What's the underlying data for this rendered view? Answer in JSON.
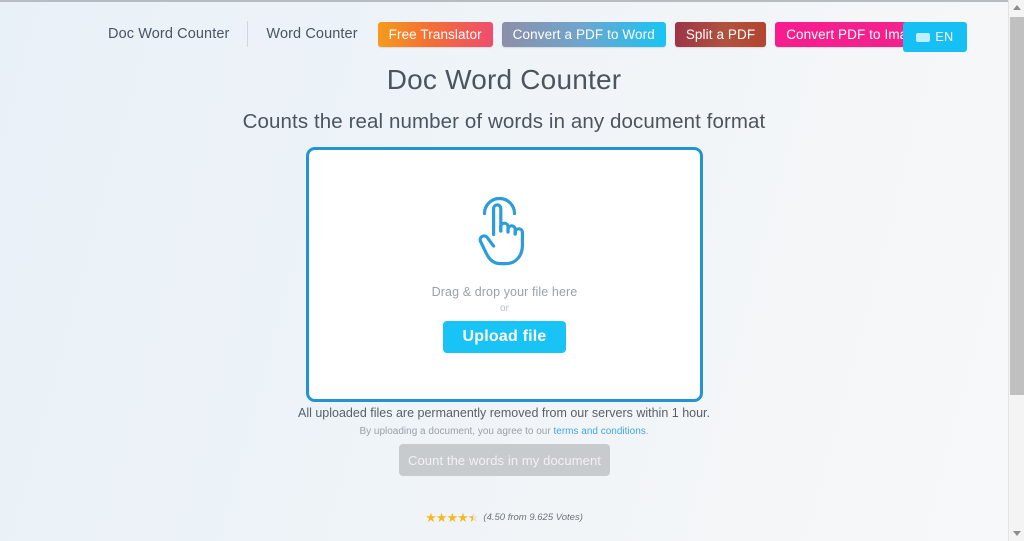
{
  "nav": {
    "brand": "Doc Word Counter",
    "word_counter": "Word Counter",
    "pills": [
      {
        "label": "Free Translator",
        "color": "#f59a1e"
      },
      {
        "label": "Convert a PDF to Word",
        "color": "#8d8fa8"
      },
      {
        "label": "Split a PDF",
        "color": "#9e3447"
      },
      {
        "label": "Convert PDF to Images",
        "color": "#f71d8e"
      }
    ],
    "language": {
      "label": "EN",
      "icon": "flag-icon"
    }
  },
  "hero": {
    "title": "Doc Word Counter",
    "subtitle": "Counts the real number of words in any document format"
  },
  "dropzone": {
    "icon": "tap-hand-icon",
    "hint": "Drag & drop your file here",
    "or": "or",
    "upload_label": "Upload file",
    "border_color": "#2294d3"
  },
  "notes": {
    "privacy": "All uploaded files are permanently removed from our servers within 1 hour.",
    "terms_prefix": "By uploading a document, you agree to our ",
    "terms_link": "terms and conditions",
    "terms_suffix": "."
  },
  "actions": {
    "count_label": "Count the words in my document",
    "count_disabled_color": "#c8cbcd"
  },
  "rating": {
    "stars_full": 4,
    "stars_half": 1,
    "text": "(4.50 from 9.625 Votes)",
    "star_color": "#f5b921"
  },
  "scrollbar": {
    "up_icon": "scroll-up-arrow-icon",
    "down_icon": "scroll-down-arrow-icon"
  }
}
